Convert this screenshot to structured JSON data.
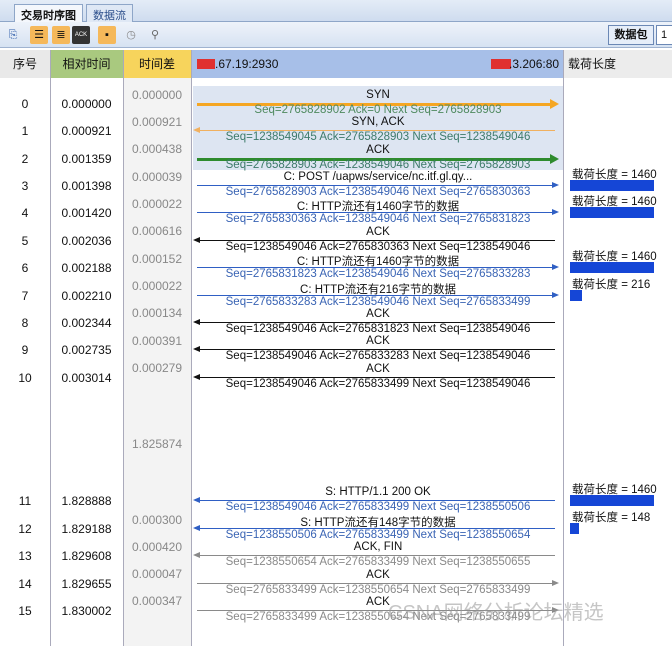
{
  "tabs": [
    "交易时序图",
    "数据流"
  ],
  "toolbar": {
    "ack_icon_label": "ACK",
    "packet_label": "数据包",
    "packet_value": "1"
  },
  "headers": {
    "seq": "序号",
    "rel_time": "相对时间",
    "delta": "时间差",
    "client": ".67.19:2930",
    "server": ".3.206:80",
    "payload": "载荷长度"
  },
  "colors": {
    "syn": "#f5a623",
    "synack": "#f0b060",
    "ack_green": "#2e8b2e",
    "data_blue": "#2f5fc4",
    "black": "#111111",
    "gray": "#8a8a8a"
  },
  "rows": [
    {
      "n": "0",
      "t": "0.000000",
      "label": "SYN",
      "seq": "Seq=2765828902  Ack=0  Next Seq=2765828903",
      "dir": "r",
      "style": "syn"
    },
    {
      "n": "1",
      "t": "0.000921",
      "label": "SYN, ACK",
      "seq": "Seq=1238549045  Ack=2765828903  Next Seq=1238549046",
      "dir": "l",
      "style": "synack"
    },
    {
      "n": "2",
      "t": "0.001359",
      "label": "ACK",
      "seq": "Seq=2765828903  Ack=1238549046  Next Seq=2765828903",
      "dir": "r",
      "style": "ack_green"
    },
    {
      "n": "3",
      "t": "0.001398",
      "label": "C: POST /uapws/service/nc.itf.gl.qy...",
      "seq": "Seq=2765828903  Ack=1238549046  Next Seq=2765830363",
      "dir": "r",
      "style": "data_blue",
      "payload": "载荷长度 = 1460",
      "plen": 1460
    },
    {
      "n": "4",
      "t": "0.001420",
      "label": "C: HTTP流还有1460字节的数据",
      "seq": "Seq=2765830363  Ack=1238549046  Next Seq=2765831823",
      "dir": "r",
      "style": "data_blue",
      "payload": "载荷长度 = 1460",
      "plen": 1460
    },
    {
      "n": "5",
      "t": "0.002036",
      "label": "ACK",
      "seq": "Seq=1238549046  Ack=2765830363  Next Seq=1238549046",
      "dir": "l",
      "style": "black"
    },
    {
      "n": "6",
      "t": "0.002188",
      "label": "C: HTTP流还有1460字节的数据",
      "seq": "Seq=2765831823  Ack=1238549046  Next Seq=2765833283",
      "dir": "r",
      "style": "data_blue",
      "payload": "载荷长度 = 1460",
      "plen": 1460
    },
    {
      "n": "7",
      "t": "0.002210",
      "label": "C: HTTP流还有216字节的数据",
      "seq": "Seq=2765833283  Ack=1238549046  Next Seq=2765833499",
      "dir": "r",
      "style": "data_blue",
      "payload": "载荷长度 = 216",
      "plen": 216
    },
    {
      "n": "8",
      "t": "0.002344",
      "label": "ACK",
      "seq": "Seq=1238549046  Ack=2765831823  Next Seq=1238549046",
      "dir": "l",
      "style": "black"
    },
    {
      "n": "9",
      "t": "0.002735",
      "label": "ACK",
      "seq": "Seq=1238549046  Ack=2765833283  Next Seq=1238549046",
      "dir": "l",
      "style": "black"
    },
    {
      "n": "10",
      "t": "0.003014",
      "label": "ACK",
      "seq": "Seq=1238549046  Ack=2765833499  Next Seq=1238549046",
      "dir": "l",
      "style": "black"
    },
    {
      "n": "11",
      "t": "1.828888",
      "label": "S: HTTP/1.1 200 OK",
      "seq": "Seq=1238549046  Ack=2765833499  Next Seq=1238550506",
      "dir": "l",
      "style": "data_blue",
      "payload": "载荷长度 = 1460",
      "plen": 1460
    },
    {
      "n": "12",
      "t": "1.829188",
      "label": "S: HTTP流还有148字节的数据",
      "seq": "Seq=1238550506  Ack=2765833499  Next Seq=1238550654",
      "dir": "l",
      "style": "data_blue",
      "payload": "载荷长度 = 148",
      "plen": 148
    },
    {
      "n": "13",
      "t": "1.829608",
      "label": "ACK, FIN",
      "seq": "Seq=1238550654  Ack=2765833499  Next Seq=1238550655",
      "dir": "l",
      "style": "gray"
    },
    {
      "n": "14",
      "t": "1.829655",
      "label": "ACK",
      "seq": "Seq=2765833499  Ack=1238550654  Next Seq=2765833499",
      "dir": "r",
      "style": "gray"
    },
    {
      "n": "15",
      "t": "1.830002",
      "label": "ACK",
      "seq": "Seq=2765833499  Ack=1238550654  Next Seq=2765833499",
      "dir": "r",
      "style": "gray"
    }
  ],
  "deltas": [
    "0.000000",
    "0.000921",
    "0.000438",
    "0.000039",
    "0.000022",
    "0.000616",
    "0.000152",
    "0.000022",
    "0.000134",
    "0.000391",
    "0.000279",
    "1.825874",
    "0.000300",
    "0.000420",
    "0.000047",
    "0.000347"
  ],
  "watermark": "CSNA网络分析论坛精选"
}
